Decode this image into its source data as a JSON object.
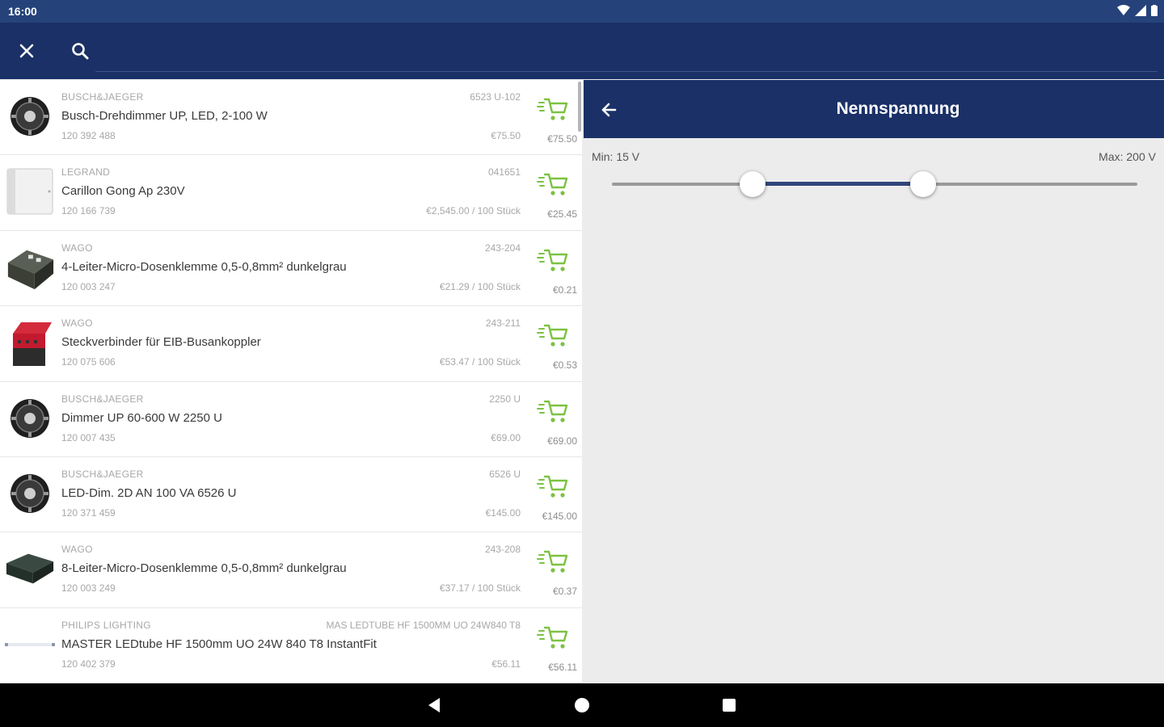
{
  "status_bar": {
    "time": "16:00"
  },
  "search": {
    "value": "",
    "placeholder": ""
  },
  "products": [
    {
      "brand": "BUSCH&JAEGER",
      "article_no": "6523 U-102",
      "name": "Busch-Drehdimmer UP, LED, 2-100 W",
      "code": "120 392 488",
      "unit_price": "€75.50",
      "price": "€75.50",
      "thumb": "dimmer-round"
    },
    {
      "brand": "LEGRAND",
      "article_no": "041651",
      "name": "Carillon Gong Ap 230V",
      "code": "120 166 739",
      "unit_price": "€2,545.00 / 100 Stück",
      "price": "€25.45",
      "thumb": "white-box"
    },
    {
      "brand": "WAGO",
      "article_no": "243-204",
      "name": "4-Leiter-Micro-Dosenklemme 0,5-0,8mm² dunkelgrau",
      "code": "120 003 247",
      "unit_price": "€21.29 / 100 Stück",
      "price": "€0.21",
      "thumb": "wago-dark"
    },
    {
      "brand": "WAGO",
      "article_no": "243-211",
      "name": "Steckverbinder für EIB-Busankoppler",
      "code": "120 075 606",
      "unit_price": "€53.47 / 100 Stück",
      "price": "€0.53",
      "thumb": "wago-red"
    },
    {
      "brand": "BUSCH&JAEGER",
      "article_no": "2250 U",
      "name": "Dimmer UP 60-600 W 2250 U",
      "code": "120 007 435",
      "unit_price": "€69.00",
      "price": "€69.00",
      "thumb": "dimmer-round"
    },
    {
      "brand": "BUSCH&JAEGER",
      "article_no": "6526 U",
      "name": "LED-Dim. 2D AN 100 VA 6526 U",
      "code": "120 371 459",
      "unit_price": "€145.00",
      "price": "€145.00",
      "thumb": "dimmer-round"
    },
    {
      "brand": "WAGO",
      "article_no": "243-208",
      "name": "8-Leiter-Micro-Dosenklemme 0,5-0,8mm² dunkelgrau",
      "code": "120 003 249",
      "unit_price": "€37.17 / 100 Stück",
      "price": "€0.37",
      "thumb": "wago-flat"
    },
    {
      "brand": "PHILIPS LIGHTING",
      "article_no": "MAS LEDTUBE HF 1500MM UO 24W840 T8",
      "name": "MASTER LEDtube HF 1500mm UO 24W 840 T8 InstantFit",
      "code": "120 402 379",
      "unit_price": "€56.11",
      "price": "€56.11",
      "thumb": "tube"
    }
  ],
  "filter": {
    "title": "Nennspannung",
    "min_label": "Min: 15 V",
    "max_label": "Max: 200 V",
    "low_fraction": 0.268,
    "high_fraction": 0.592
  },
  "colors": {
    "primary_dark": "#1a3066",
    "status_bar": "#25437a",
    "cart_green": "#7cc242",
    "slider_active": "#30457a"
  },
  "icons": {
    "close": "close-icon",
    "search": "search-icon",
    "back": "arrow-left-icon",
    "cart": "add-to-cart-icon",
    "nav_back": "nav-back-icon",
    "nav_home": "nav-home-icon",
    "nav_recents": "nav-recents-icon"
  }
}
